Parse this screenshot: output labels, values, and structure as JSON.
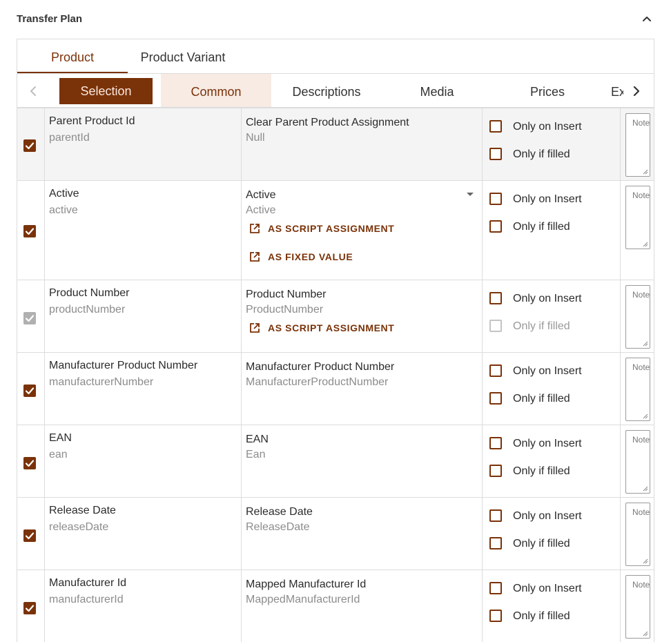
{
  "section": {
    "title": "Transfer Plan"
  },
  "main_tabs": [
    {
      "label": "Product",
      "active": true
    },
    {
      "label": "Product Variant",
      "active": false
    }
  ],
  "sub_tabs": [
    {
      "label": "Selection",
      "state": "selected"
    },
    {
      "label": "Common",
      "state": "active"
    },
    {
      "label": "Descriptions",
      "state": "normal"
    },
    {
      "label": "Media",
      "state": "normal"
    },
    {
      "label": "Prices",
      "state": "normal"
    },
    {
      "label": "Ex",
      "state": "clipped"
    }
  ],
  "colors": {
    "accent": "#7a3208",
    "accent_light": "#f7ebe4",
    "selected_text": "#fbe7dc",
    "muted": "#8c8c8c",
    "border": "#dcdcdc"
  },
  "labels": {
    "only_on_insert": "Only on Insert",
    "only_if_filled": "Only if filled",
    "note_placeholder": "Note",
    "as_script_assignment": "AS SCRIPT ASSIGNMENT",
    "as_fixed_value": "AS FIXED VALUE"
  },
  "rows": [
    {
      "checked": true,
      "check_disabled": false,
      "highlight": true,
      "source_label": "Parent Product Id",
      "source_key": "parentId",
      "target_label": "Clear Parent Product Assignment",
      "target_key": "Null",
      "dropdown": false,
      "actions": [],
      "only_if_filled_disabled": false
    },
    {
      "checked": true,
      "check_disabled": false,
      "highlight": false,
      "source_label": "Active",
      "source_key": "active",
      "target_label": "Active",
      "target_key": "Active",
      "dropdown": true,
      "actions": [
        "AS SCRIPT ASSIGNMENT",
        "AS FIXED VALUE"
      ],
      "only_if_filled_disabled": false
    },
    {
      "checked": true,
      "check_disabled": true,
      "highlight": false,
      "source_label": "Product Number",
      "source_key": "productNumber",
      "target_label": "Product Number",
      "target_key": "ProductNumber",
      "dropdown": false,
      "actions": [
        "AS SCRIPT ASSIGNMENT"
      ],
      "only_if_filled_disabled": true
    },
    {
      "checked": true,
      "check_disabled": false,
      "highlight": false,
      "source_label": "Manufacturer Product Number",
      "source_key": "manufacturerNumber",
      "target_label": "Manufacturer Product Number",
      "target_key": "ManufacturerProductNumber",
      "dropdown": false,
      "actions": [],
      "only_if_filled_disabled": false
    },
    {
      "checked": true,
      "check_disabled": false,
      "highlight": false,
      "source_label": "EAN",
      "source_key": "ean",
      "target_label": "EAN",
      "target_key": "Ean",
      "dropdown": false,
      "actions": [],
      "only_if_filled_disabled": false
    },
    {
      "checked": true,
      "check_disabled": false,
      "highlight": false,
      "source_label": "Release Date",
      "source_key": "releaseDate",
      "target_label": "Release Date",
      "target_key": "ReleaseDate",
      "dropdown": false,
      "actions": [],
      "only_if_filled_disabled": false
    },
    {
      "checked": true,
      "check_disabled": false,
      "highlight": false,
      "source_label": "Manufacturer Id",
      "source_key": "manufacturerId",
      "target_label": "Mapped Manufacturer Id",
      "target_key": "MappedManufacturerId",
      "dropdown": false,
      "actions": [],
      "only_if_filled_disabled": false
    }
  ]
}
